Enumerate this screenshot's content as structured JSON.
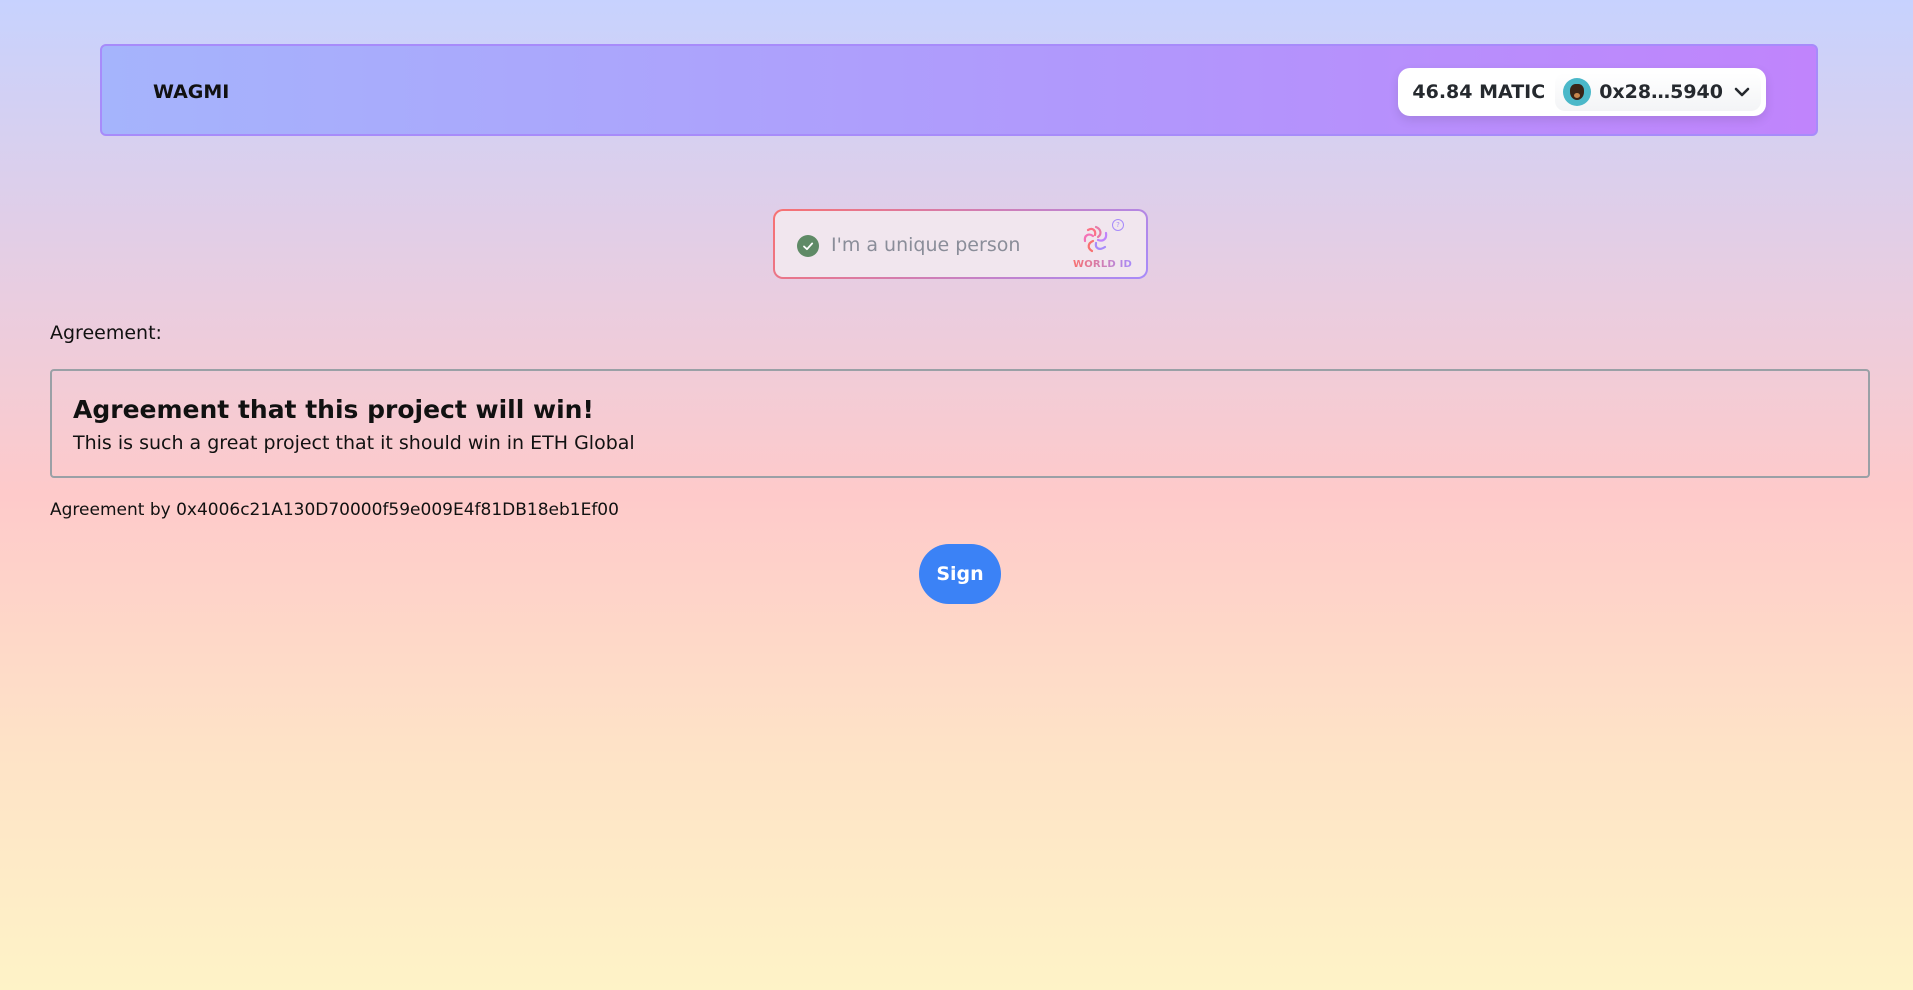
{
  "navbar": {
    "brand": "WAGMI",
    "wallet": {
      "balance": "46.84 MATIC",
      "address": "0x28…5940",
      "avatar_icon": "dog-avatar-icon",
      "dropdown_icon": "chevron-down-icon"
    }
  },
  "world_id": {
    "label": "I'm a unique person",
    "caption": "WORLD ID",
    "help": "?",
    "verified": true,
    "check_icon": "check-circle-icon",
    "logo_icon": "worldcoin-logo-icon",
    "help_icon": "help-icon",
    "check_color": "#5f8a66"
  },
  "agreement": {
    "label": "Agreement:",
    "title": "Agreement that this project will win!",
    "body": "This is such a great project that it should win in ETH Global",
    "by": "Agreement by 0x4006c21A130D70000f59e009E4f81DB18eb1Ef00"
  },
  "actions": {
    "sign_label": "Sign",
    "sign_color": "#3b82f6"
  }
}
